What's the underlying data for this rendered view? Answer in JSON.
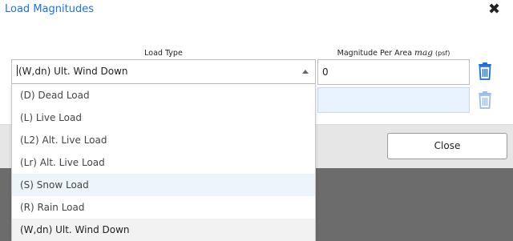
{
  "dialog": {
    "title": "Load Magnitudes",
    "close_glyph": "✖",
    "close_button_label": "Close"
  },
  "columns": {
    "load_type_label": "Load Type",
    "magnitude_label_prefix": "Magnitude Per Area",
    "magnitude_var": "mag",
    "magnitude_unit": "(psf)"
  },
  "rows": [
    {
      "load_type": "(W,dn) Ult. Wind Down",
      "magnitude": "0"
    }
  ],
  "dropdown": {
    "options": [
      {
        "label": "(D) Dead Load"
      },
      {
        "label": "(L) Live Load"
      },
      {
        "label": "(L2) Alt. Live Load"
      },
      {
        "label": "(Lr) Alt. Live Load"
      },
      {
        "label": "(S) Snow Load"
      },
      {
        "label": "(R) Rain Load"
      },
      {
        "label": "(W,dn) Ult. Wind Down"
      }
    ],
    "highlighted_index": 4,
    "selected_index": 6
  },
  "icons": {
    "close": "close-icon",
    "delete": "trash-icon",
    "caret": "caret-up-icon"
  },
  "colors": {
    "title": "#1a73e8",
    "trash_icon": "#1a6fd6",
    "input_empty_bg": "#e8f3ff"
  }
}
